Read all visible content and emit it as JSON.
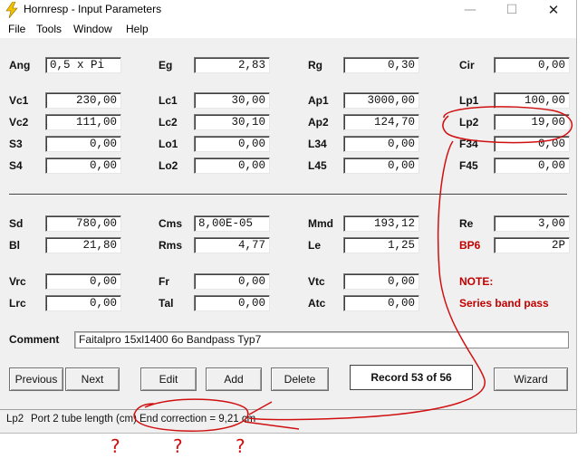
{
  "window": {
    "title": "Hornresp - Input Parameters",
    "minimize_glyph": "—",
    "maximize_glyph": "☐",
    "close_glyph": "✕"
  },
  "menu": [
    "File",
    "Tools",
    "Window",
    "Help"
  ],
  "params": {
    "ang": {
      "label": "Ang",
      "value": "0,5 x Pi"
    },
    "eg": {
      "label": "Eg",
      "value": "2,83"
    },
    "rg": {
      "label": "Rg",
      "value": "0,30"
    },
    "cir": {
      "label": "Cir",
      "value": "0,00"
    },
    "vc1": {
      "label": "Vc1",
      "value": "230,00"
    },
    "lc1": {
      "label": "Lc1",
      "value": "30,00"
    },
    "ap1": {
      "label": "Ap1",
      "value": "3000,00"
    },
    "lp1": {
      "label": "Lp1",
      "value": "100,00"
    },
    "vc2": {
      "label": "Vc2",
      "value": "111,00"
    },
    "lc2": {
      "label": "Lc2",
      "value": "30,10"
    },
    "ap2": {
      "label": "Ap2",
      "value": "124,70"
    },
    "lp2": {
      "label": "Lp2",
      "value": "19,00"
    },
    "s3": {
      "label": "S3",
      "value": "0,00"
    },
    "lo1": {
      "label": "Lo1",
      "value": "0,00"
    },
    "l34": {
      "label": "L34",
      "value": "0,00"
    },
    "f34": {
      "label": "F34",
      "value": "0,00"
    },
    "s4": {
      "label": "S4",
      "value": "0,00"
    },
    "lo2": {
      "label": "Lo2",
      "value": "0,00"
    },
    "l45": {
      "label": "L45",
      "value": "0,00"
    },
    "f45": {
      "label": "F45",
      "value": "0,00"
    },
    "sd": {
      "label": "Sd",
      "value": "780,00"
    },
    "cms": {
      "label": "Cms",
      "value": "8,00E-05"
    },
    "mmd": {
      "label": "Mmd",
      "value": "193,12"
    },
    "re": {
      "label": "Re",
      "value": "3,00"
    },
    "bl": {
      "label": "Bl",
      "value": "21,80"
    },
    "rms": {
      "label": "Rms",
      "value": "4,77"
    },
    "le": {
      "label": "Le",
      "value": "1,25"
    },
    "bp6": {
      "label": "BP6",
      "value": "2P"
    },
    "vrc": {
      "label": "Vrc",
      "value": "0,00"
    },
    "fr": {
      "label": "Fr",
      "value": "0,00"
    },
    "vtc": {
      "label": "Vtc",
      "value": "0,00"
    },
    "lrc": {
      "label": "Lrc",
      "value": "0,00"
    },
    "tal": {
      "label": "Tal",
      "value": "0,00"
    },
    "atc": {
      "label": "Atc",
      "value": "0,00"
    }
  },
  "note": {
    "title": "NOTE:",
    "text": "Series band pass"
  },
  "comment": {
    "label": "Comment",
    "value": "Faitalpro 15xl1400  6o Bandpass Typ7"
  },
  "buttons": {
    "previous": "Previous",
    "next": "Next",
    "edit": "Edit",
    "add": "Add",
    "delete": "Delete",
    "record": "Record 53 of 56",
    "wizard": "Wizard"
  },
  "status": {
    "field": "Lp2",
    "description": "Port 2 tube length  (cm)",
    "end_correction": "End correction = 9,21 cm"
  },
  "annotation": {
    "marks": "? ? ?",
    "color": "#d01010"
  },
  "colors": {
    "note_red": "#c00000",
    "window_bg": "#f0f0f0"
  }
}
